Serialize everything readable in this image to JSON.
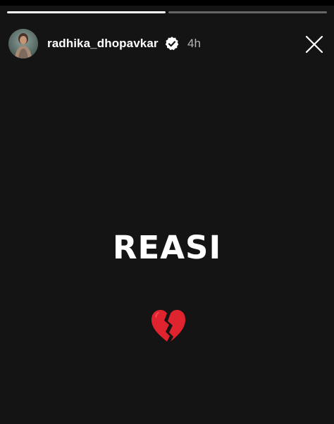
{
  "story": {
    "progress": [
      1.0,
      0.0
    ],
    "user": {
      "username": "radhika_dhopavkar",
      "timestamp": "4h",
      "verified": true,
      "avatar_icon": "profile-avatar"
    },
    "close_icon": "close-icon",
    "text": "REASI",
    "emoji": "broken-heart",
    "colors": {
      "background": "#141414",
      "text": "#ffffff",
      "timestamp": "#b5b5b5",
      "progress_track": "rgba(255,255,255,0.35)",
      "progress_fill": "#ffffff",
      "heart": "#e0242f"
    }
  }
}
